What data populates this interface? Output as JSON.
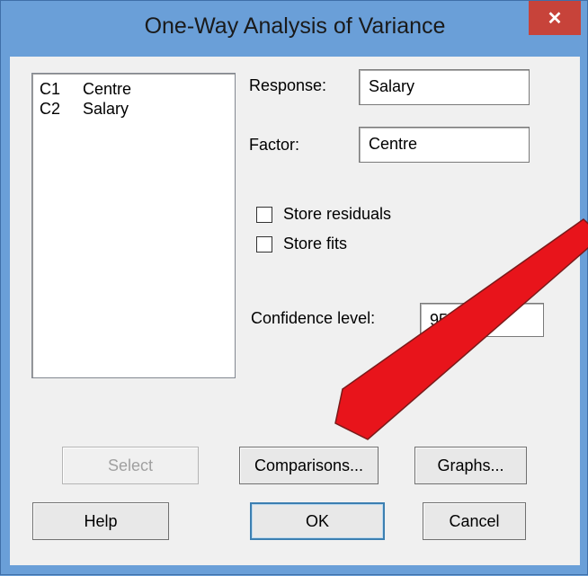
{
  "window": {
    "title": "One-Way Analysis of Variance",
    "close_glyph": "✕"
  },
  "variables": [
    {
      "id": "C1",
      "name": "Centre"
    },
    {
      "id": "C2",
      "name": "Salary"
    }
  ],
  "response": {
    "label": "Response:",
    "value": "Salary"
  },
  "factor": {
    "label": "Factor:",
    "value": "Centre"
  },
  "options": {
    "store_residuals": {
      "label": "Store residuals",
      "checked": false
    },
    "store_fits": {
      "label": "Store fits",
      "checked": false
    }
  },
  "confidence": {
    "label": "Confidence level:",
    "value": "95.0"
  },
  "buttons": {
    "select": "Select",
    "comparisons": "Comparisons...",
    "graphs": "Graphs...",
    "help": "Help",
    "ok": "OK",
    "cancel": "Cancel"
  },
  "annotation": {
    "type": "arrow",
    "color": "#e8141b",
    "target": "Comparisons..."
  }
}
